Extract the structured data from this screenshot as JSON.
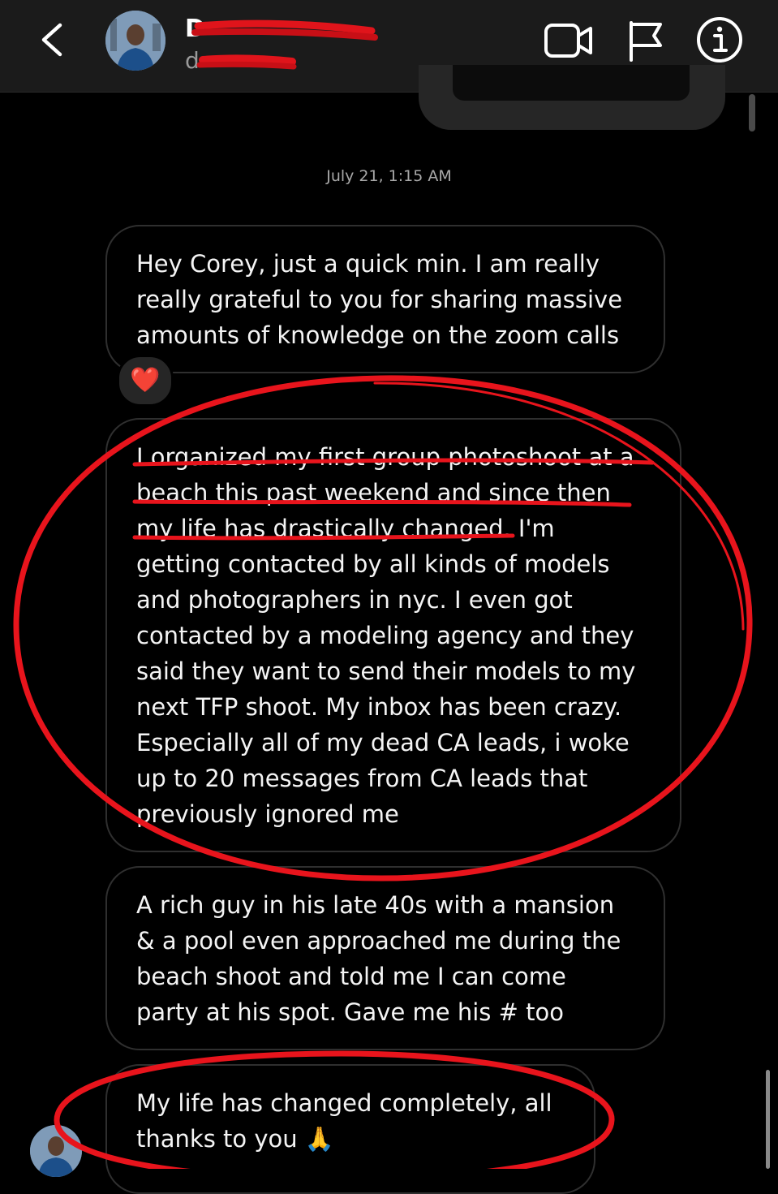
{
  "header": {
    "name": "D",
    "username": "d",
    "icons": [
      "back-icon",
      "video-camera-icon",
      "flag-icon",
      "info-icon"
    ]
  },
  "conversation": {
    "timestamp": "July 21, 1:15 AM",
    "messages": [
      {
        "text": "Hey Corey, just a quick min. I am really\nreally grateful to you for sharing massive\namounts of knowledge on the zoom calls",
        "reaction": "❤️"
      },
      {
        "text": "I organized my first group photoshoot at a\nbeach this past weekend and since then\nmy life has drastically changed. I'm\ngetting contacted by all kinds of models\nand photographers in nyc. I even got\ncontacted by a modeling agency and they\nsaid they want to send their models to my\nnext TFP shoot. My inbox has been crazy.\nEspecially all of my dead CA leads, i woke\nup to 20 messages from CA leads that\npreviously ignored me"
      },
      {
        "text": "A rich guy in his late 40s with a mansion\n& a pool even approached me during the\nbeach shoot and told me I can come\nparty at his spot. Gave me his # too"
      },
      {
        "text": "My life has changed completely, all\nthanks to you 🙏"
      }
    ]
  },
  "colors": {
    "header_bg": "#1b1b1b",
    "bubble_border": "#2f2f2f",
    "annotation_red": "#e8141c"
  }
}
